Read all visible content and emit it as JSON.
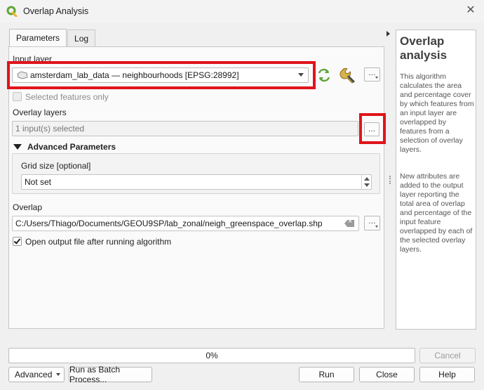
{
  "window": {
    "title": "Overlap Analysis",
    "close_glyph": "✕"
  },
  "tabs": [
    {
      "label": "Parameters",
      "active": true
    },
    {
      "label": "Log",
      "active": false
    }
  ],
  "params": {
    "input_layer_label": "Input layer",
    "input_layer_value": "amsterdam_lab_data — neighbourhoods [EPSG:28992]",
    "selected_only_label": "Selected features only",
    "selected_only_checked": false,
    "overlay_layers_label": "Overlay layers",
    "overlay_layers_value": "1 input(s) selected",
    "advanced_label": "Advanced Parameters",
    "grid_size_label": "Grid size [optional]",
    "grid_size_value": "Not set",
    "overlap_label": "Overlap",
    "overlap_value": "C:/Users/Thiago/Documents/GEOU9SP/lab_zonal/neigh_greenspace_overlap.shp",
    "open_output_label": "Open output file after running algorithm",
    "open_output_checked": true,
    "dots_label": "…"
  },
  "help": {
    "title": "Overlap analysis",
    "p1": "This algorithm calculates the area and percentage cover by which features from an input layer are overlapped by features from a selection of overlay layers.",
    "p2": "New attributes are added to the output layer reporting the total area of overlap and percentage of the input feature overlapped by each of the selected overlay layers."
  },
  "progress": {
    "text": "0%",
    "value": 0
  },
  "buttons": {
    "cancel": "Cancel",
    "advanced": "Advanced",
    "batch": "Run as Batch Process...",
    "run": "Run",
    "close": "Close",
    "help": "Help"
  },
  "colors": {
    "highlight": "#e0141b",
    "qgis_green": "#5fa53a"
  },
  "icons": {
    "app": "qgis-logo-icon",
    "layer": "polygon-layer-icon",
    "iterate": "iterate-icon",
    "settings": "wrench-icon"
  }
}
